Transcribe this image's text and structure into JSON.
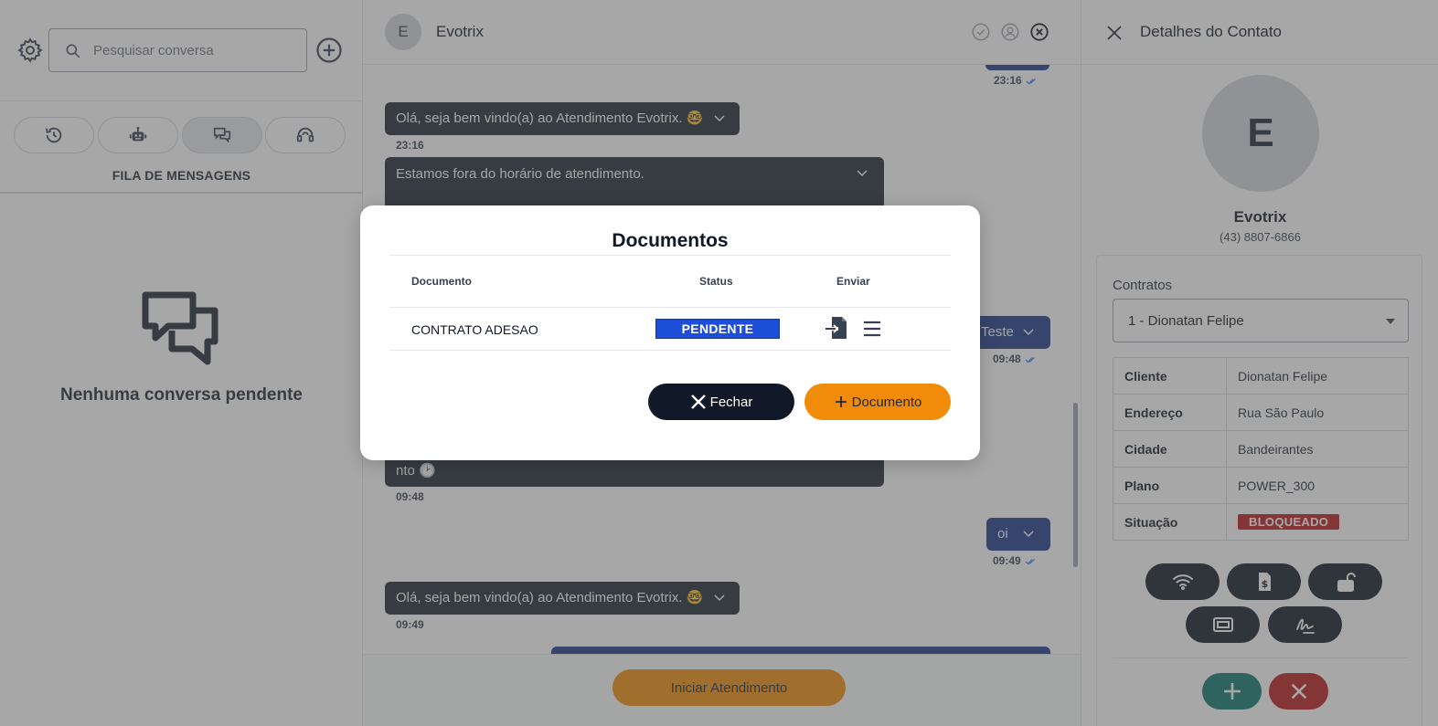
{
  "left": {
    "search": {
      "placeholder": "Pesquisar conversa",
      "value": ""
    },
    "tabs": [
      {
        "icon": "history-icon",
        "active": false
      },
      {
        "icon": "bot-icon",
        "active": false
      },
      {
        "icon": "chat-icon",
        "active": true
      },
      {
        "icon": "headset-icon",
        "active": false
      }
    ],
    "queue_title": "FILA DE MENSAGENS",
    "empty_text": "Nenhuma conversa pendente"
  },
  "chat": {
    "header": {
      "avatar_letter": "E",
      "name": "Evotrix"
    },
    "messages": [
      {
        "dir": "out",
        "text": "",
        "time": "23:16",
        "read": true
      },
      {
        "dir": "in",
        "text": "Olá, seja bem vindo(a) ao Atendimento Evotrix. 🤓",
        "time": "23:16"
      },
      {
        "dir": "in",
        "text": "Estamos fora do horário de atendimento.",
        "tail": "nto 🕑",
        "time": "09:48"
      },
      {
        "dir": "out",
        "text": "Teste",
        "time": "09:48",
        "read": true
      },
      {
        "dir": "out",
        "text": "oi",
        "time": "09:49",
        "read": true
      },
      {
        "dir": "in",
        "text": "Olá, seja bem vindo(a) ao Atendimento Evotrix. 🤓",
        "time": "09:49"
      }
    ],
    "start_button": "Iniciar Atendimento"
  },
  "contact": {
    "title": "Detalhes do Contato",
    "avatar_letter": "E",
    "name": "Evotrix",
    "phone": "(43) 8807-6866",
    "contracts_label": "Contratos",
    "selected_contract": "1 - Dionatan Felipe",
    "info": [
      {
        "key": "Cliente",
        "value": "Dionatan Felipe"
      },
      {
        "key": "Endereço",
        "value": "Rua São Paulo"
      },
      {
        "key": "Cidade",
        "value": "Bandeirantes"
      },
      {
        "key": "Plano",
        "value": "POWER_300"
      },
      {
        "key": "Situação",
        "value": "BLOQUEADO"
      }
    ],
    "actions": [
      "wifi-icon",
      "invoice-icon",
      "unlock-icon",
      "ticket-icon",
      "signature-icon"
    ],
    "colors": {
      "add": "#0f766e",
      "remove": "#b91c1c",
      "blocked": "#b91c1c"
    }
  },
  "modal": {
    "title": "Documentos",
    "columns": [
      "Documento",
      "Status",
      "Enviar"
    ],
    "rows": [
      {
        "document": "CONTRATO ADESAO",
        "status": "PENDENTE"
      }
    ],
    "close_label": "Fechar",
    "add_label": "Documento",
    "colors": {
      "pending": "#1d4ed8",
      "primary": "#f08c0a",
      "dark": "#111827"
    }
  }
}
